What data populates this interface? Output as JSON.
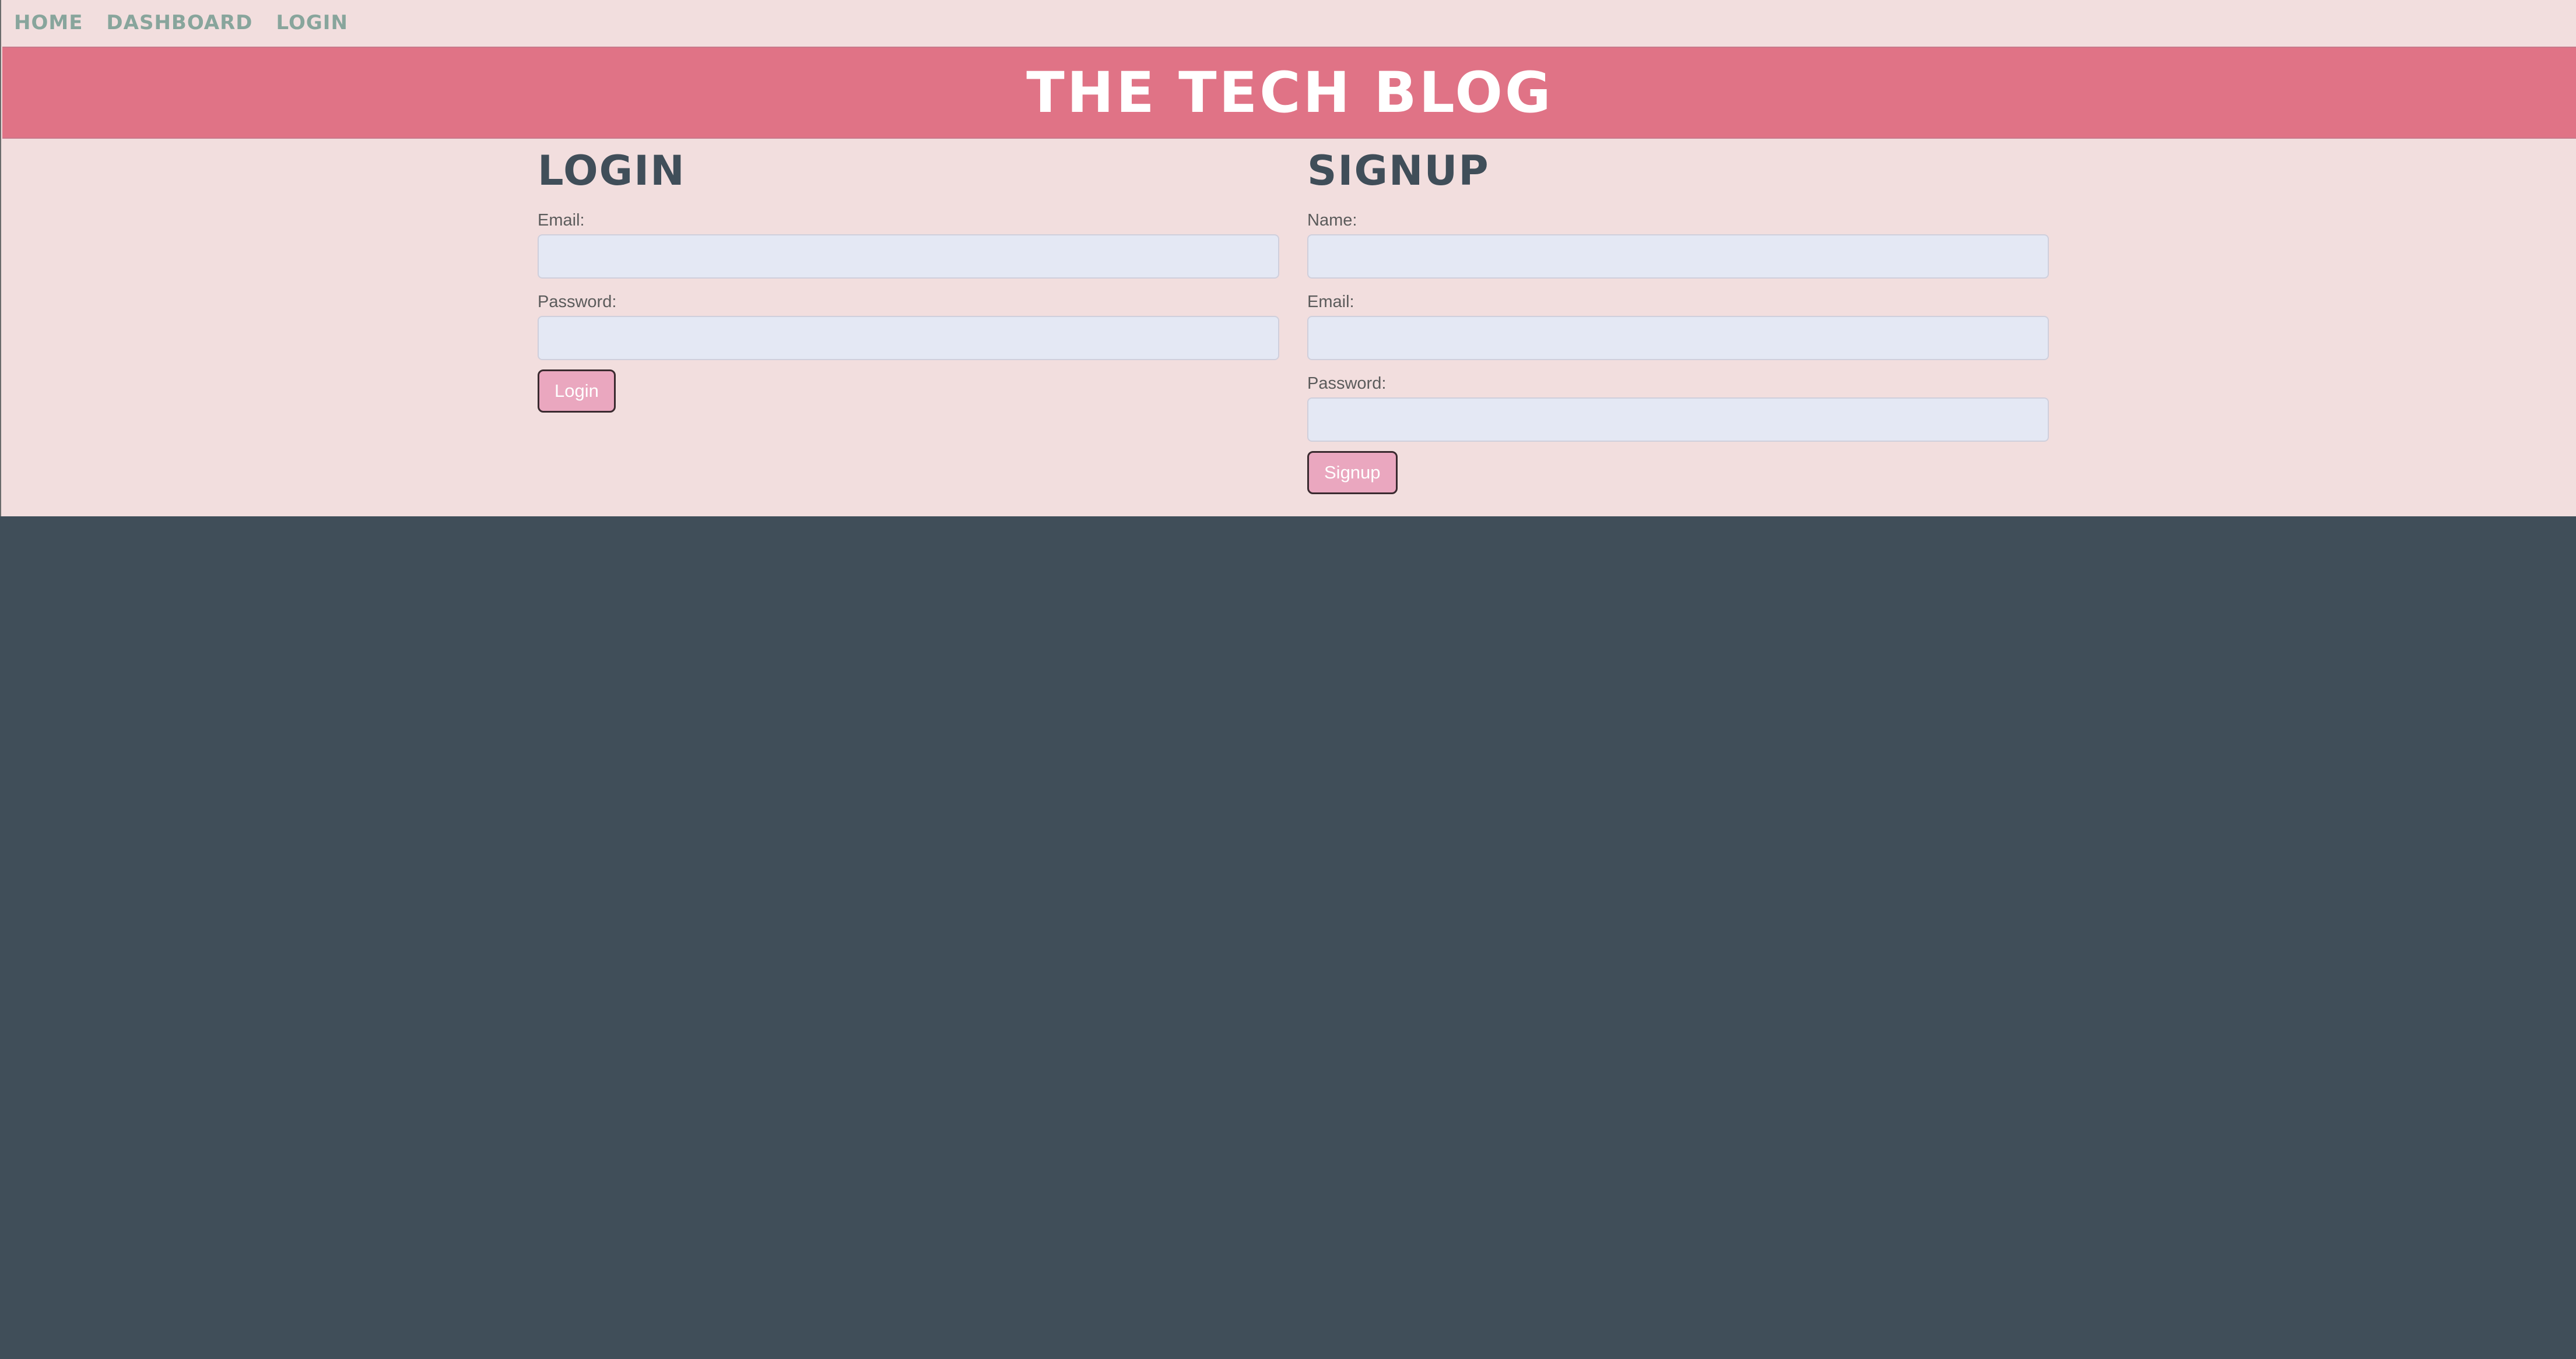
{
  "nav": {
    "items": [
      "HOME",
      "DASHBOARD",
      "LOGIN"
    ]
  },
  "header": {
    "title": "THE TECH BLOG"
  },
  "login": {
    "heading": "LOGIN",
    "email_label": "Email:",
    "email_value": "",
    "password_label": "Password:",
    "password_value": "",
    "button": "Login"
  },
  "signup": {
    "heading": "SIGNUP",
    "name_label": "Name:",
    "name_value": "",
    "email_label": "Email:",
    "email_value": "",
    "password_label": "Password:",
    "password_value": "",
    "button": "Signup"
  },
  "colors": {
    "page_background": "#f2dede",
    "header_background": "#e07386",
    "footer_background": "#404e59",
    "nav_link": "#88a59c",
    "heading": "#404e59",
    "input_background": "#e4e8f4",
    "button_background": "#eaa7bf"
  }
}
